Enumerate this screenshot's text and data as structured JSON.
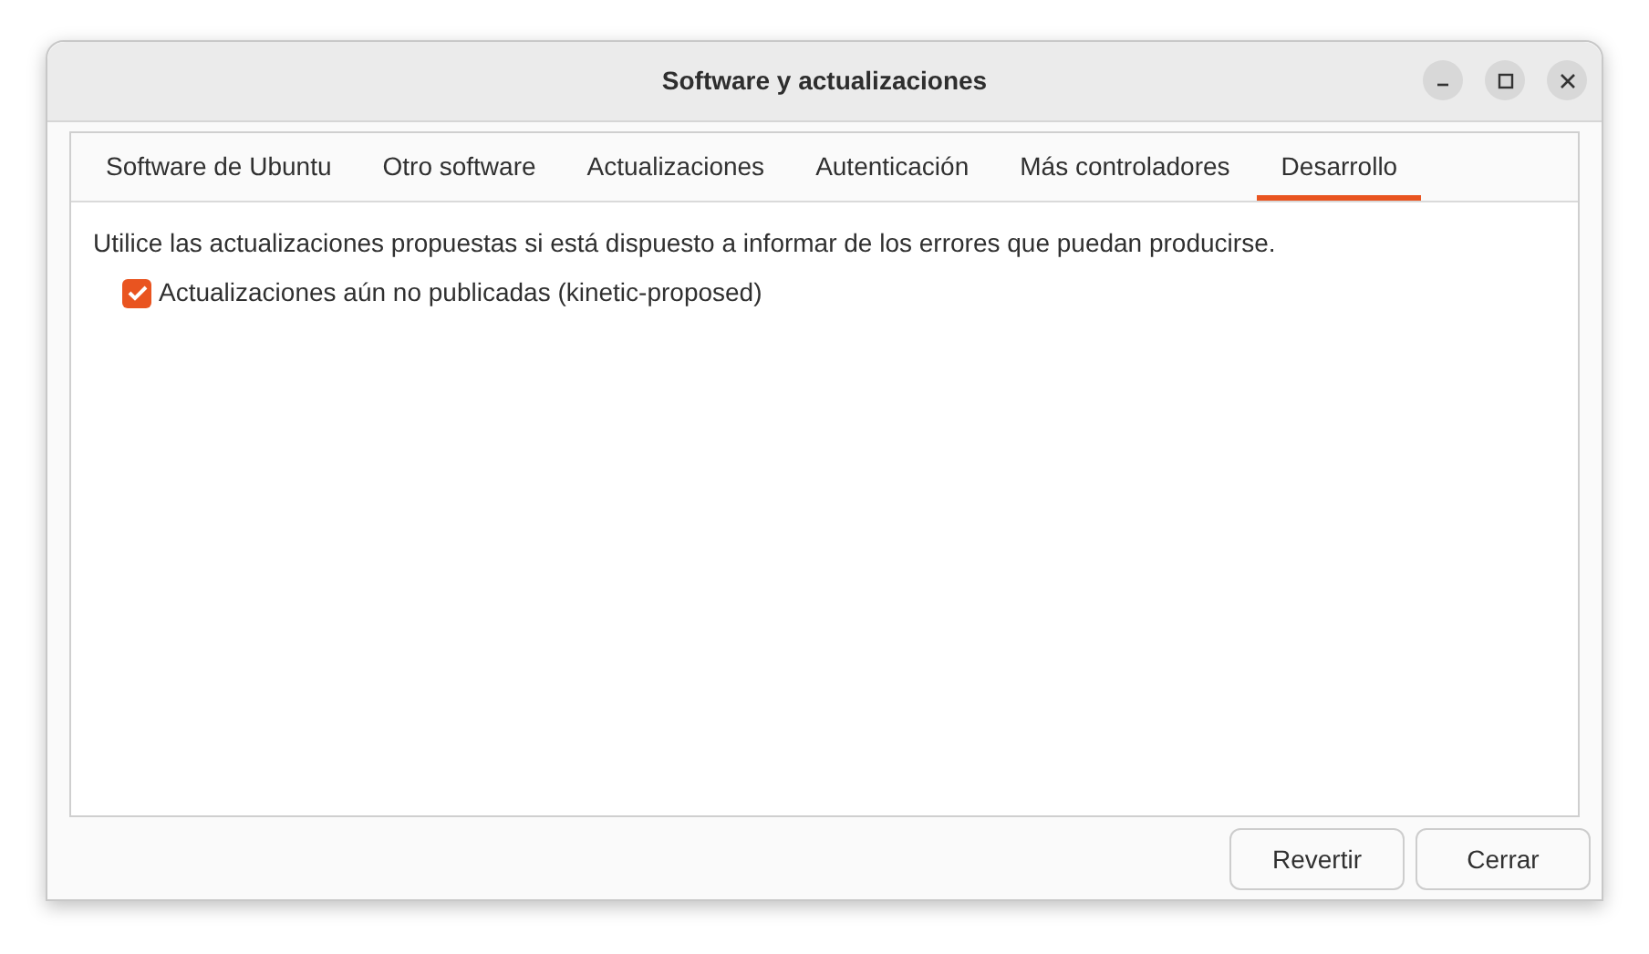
{
  "window": {
    "title": "Software y actualizaciones"
  },
  "tabs": [
    {
      "label": "Software de Ubuntu",
      "selected": false
    },
    {
      "label": "Otro software",
      "selected": false
    },
    {
      "label": "Actualizaciones",
      "selected": false
    },
    {
      "label": "Autenticación",
      "selected": false
    },
    {
      "label": "Más controladores",
      "selected": false
    },
    {
      "label": "Desarrollo",
      "selected": true
    }
  ],
  "description": "Utilice las actualizaciones propuestas si está dispuesto a informar de los errores que puedan producirse.",
  "options": [
    {
      "label": "Actualizaciones aún no publicadas (kinetic-proposed)",
      "checked": true
    }
  ],
  "buttons": [
    "Revertir",
    "Cerrar"
  ]
}
